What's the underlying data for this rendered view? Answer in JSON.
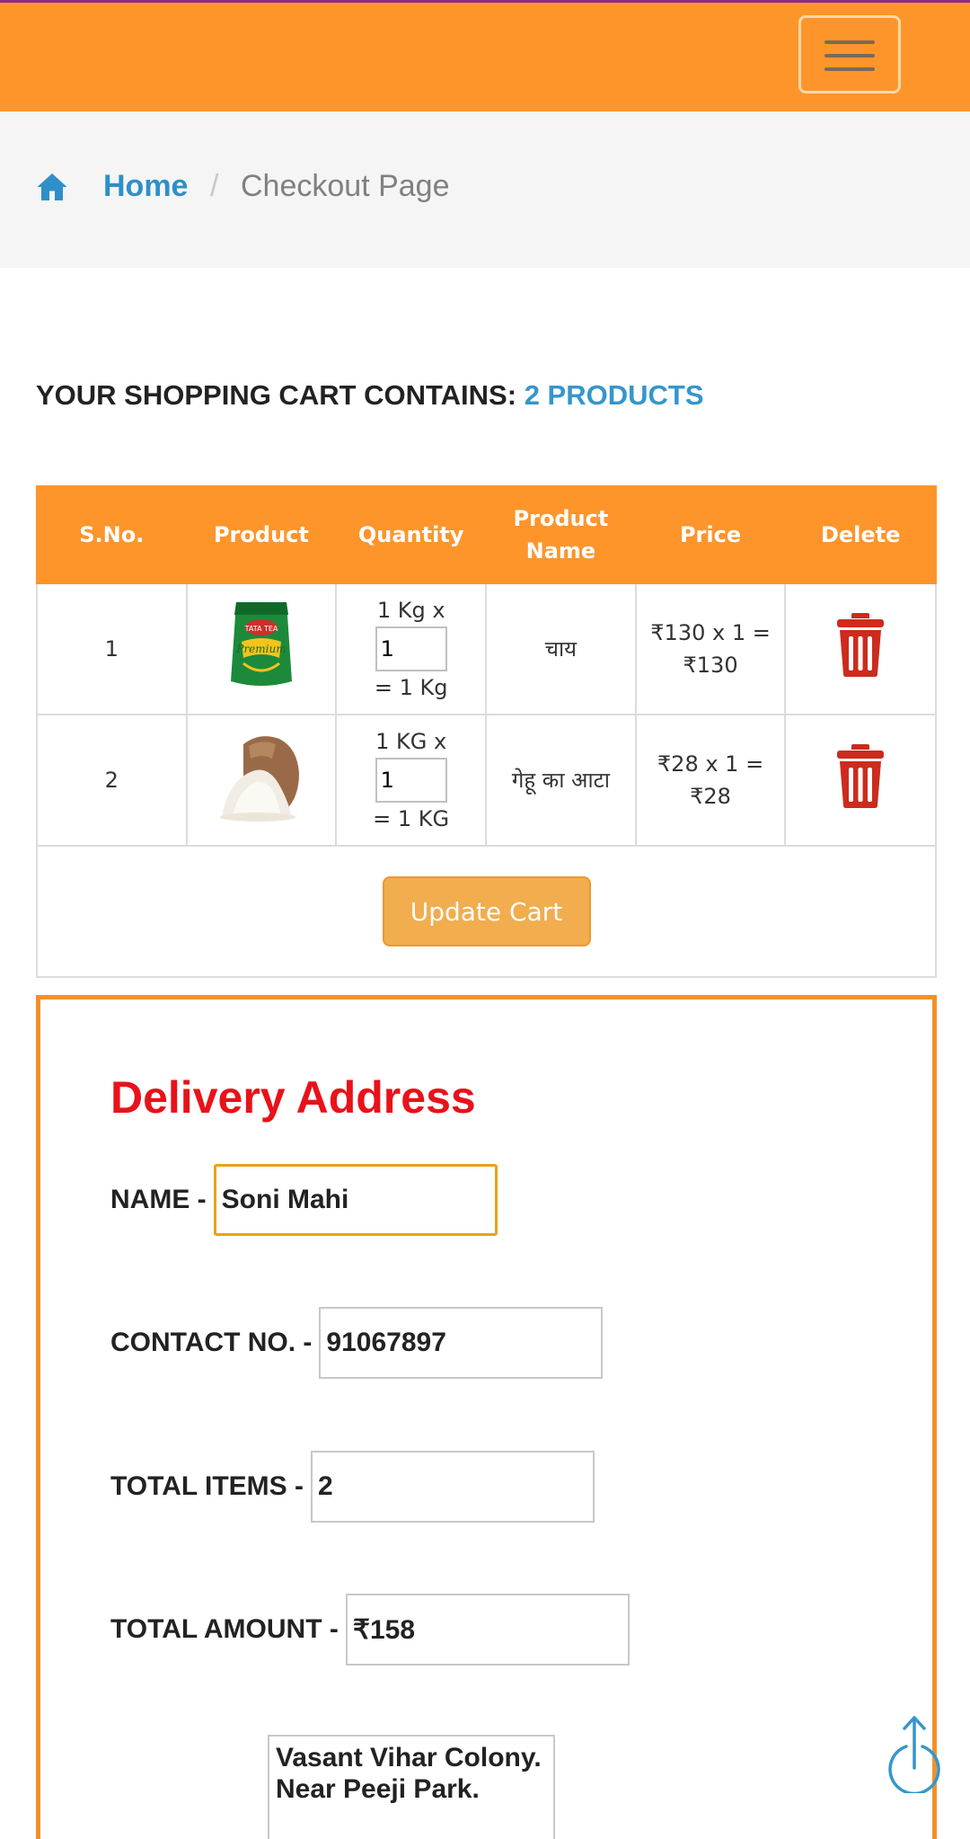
{
  "header": {
    "menu_icon": "hamburger-icon",
    "brand_color": "#fd952b"
  },
  "breadcrumb": {
    "home_icon": "home-icon",
    "home_label": "Home",
    "separator": "/",
    "current": "Checkout Page"
  },
  "cart": {
    "heading_prefix": "YOUR SHOPPING CART CONTAINS:",
    "heading_count": "2 PRODUCTS",
    "columns": [
      "S.No.",
      "Product",
      "Quantity",
      "Product Name",
      "Price",
      "Delete"
    ],
    "rows": [
      {
        "sno": "1",
        "image": "tea-pack-image",
        "qty_unit": "1 Kg x",
        "qty_value": "1",
        "qty_total": "= 1 Kg",
        "name": "चाय",
        "price_line1": "₹130 x 1 =",
        "price_line2": "₹130",
        "delete_icon": "trash-icon"
      },
      {
        "sno": "2",
        "image": "flour-sack-image",
        "qty_unit": "1 KG x",
        "qty_value": "1",
        "qty_total": "= 1 KG",
        "name": "गेहू का आटा",
        "price_line1": "₹28 x 1 = ₹28",
        "price_line2": "",
        "delete_icon": "trash-icon"
      }
    ],
    "update_label": "Update Cart"
  },
  "delivery": {
    "title": "Delivery Address",
    "name_label": "NAME -",
    "name_value": "Soni Mahi",
    "contact_label": "CONTACT NO. -",
    "contact_value": "91067897",
    "items_label": "TOTAL ITEMS -",
    "items_value": "2",
    "amount_label": "TOTAL AMOUNT -",
    "amount_value": "₹158",
    "address_value": "Vasant Vihar Colony. Near Peeji Park."
  },
  "scroll_top_icon": "scroll-to-top-icon"
}
